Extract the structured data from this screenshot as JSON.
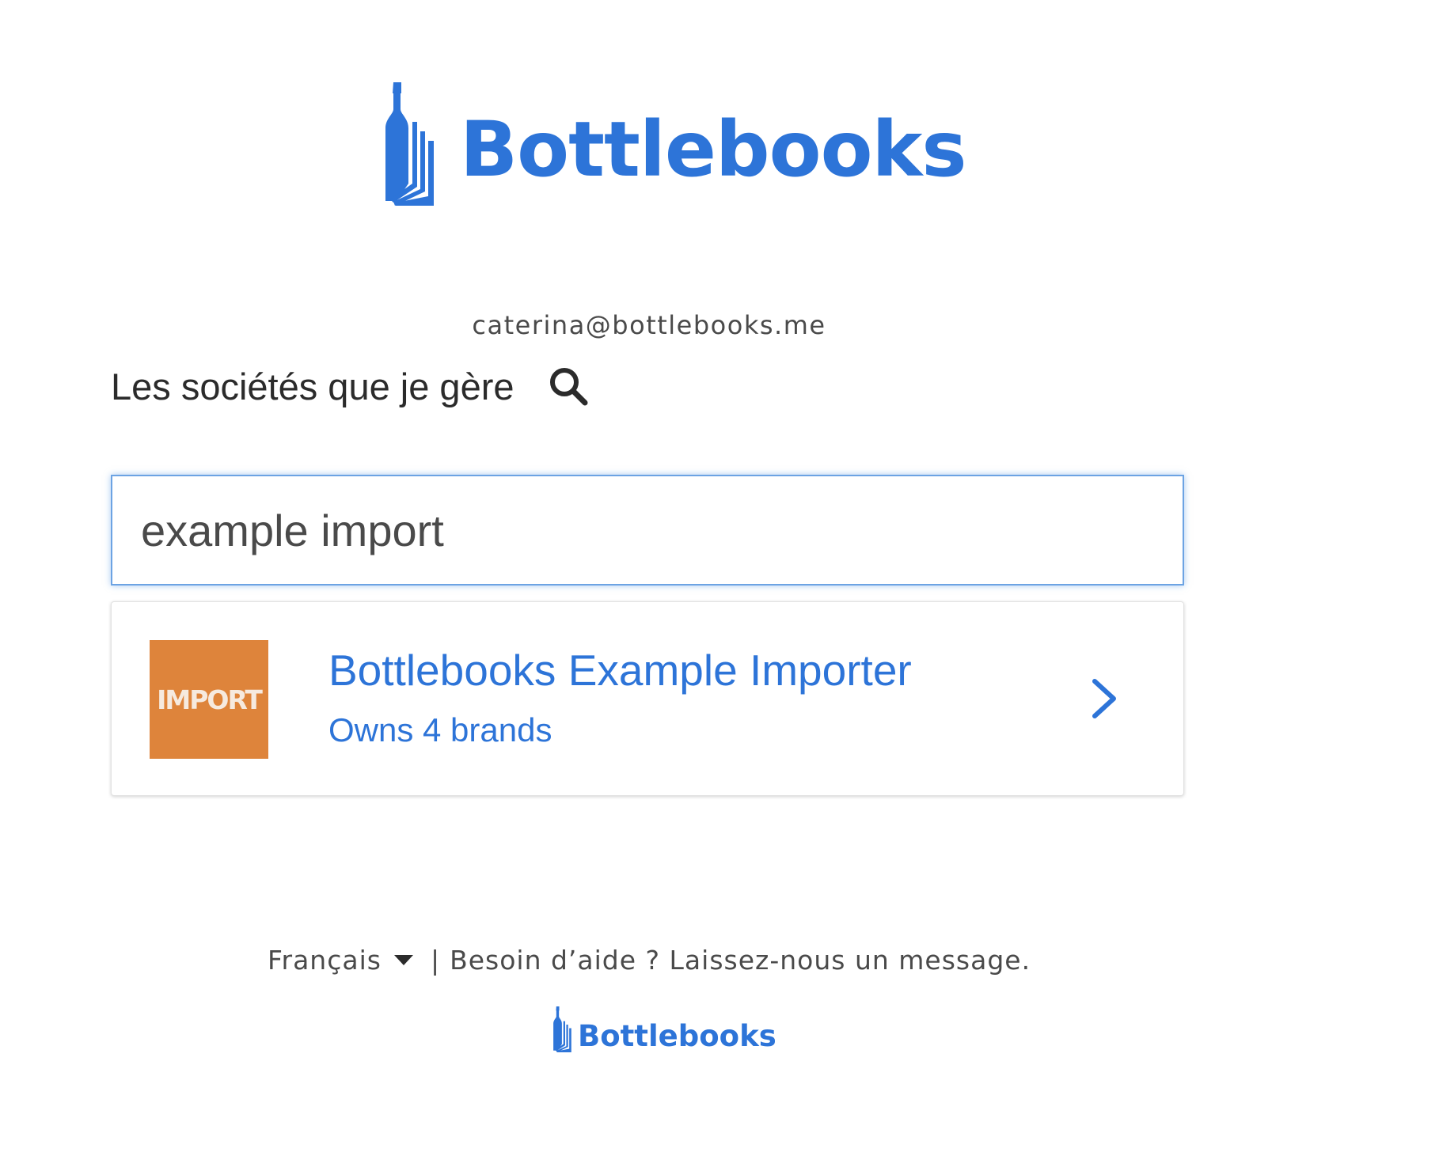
{
  "brand": {
    "name": "Bottlebooks",
    "color": "#2d74d8"
  },
  "user": {
    "email": "caterina@bottlebooks.me"
  },
  "companies": {
    "heading": "Les sociétés que je gère",
    "search_icon": "search-icon"
  },
  "search": {
    "value": "example import",
    "placeholder": ""
  },
  "results": [
    {
      "name": "Bottlebooks Example Importer",
      "subtitle": "Owns 4 brands",
      "thumbnail_text": "IMPORT",
      "thumbnail_color": "#de843b",
      "icon": "chevron-right-icon"
    }
  ],
  "footer": {
    "language": "Français",
    "separator": "|",
    "help": "Besoin d’aide ? Laissez-nous un message.",
    "logo_text": "Bottlebooks"
  }
}
